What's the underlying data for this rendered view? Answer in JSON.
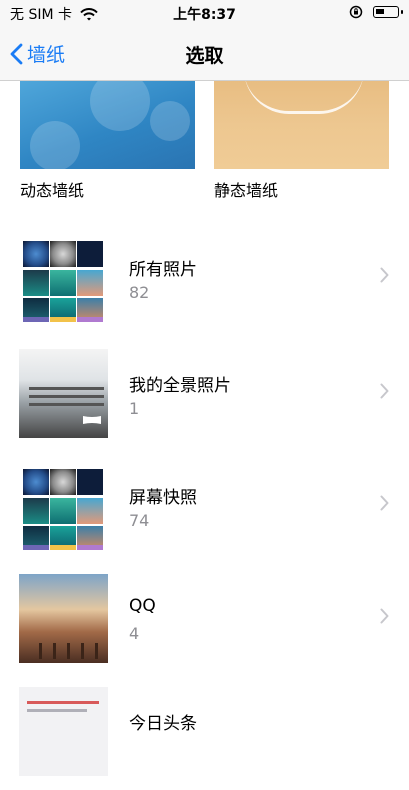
{
  "status_bar": {
    "carrier": "无 SIM 卡",
    "time": "上午8:37",
    "icons": [
      "wifi-icon",
      "rotation-lock-icon",
      "battery-icon"
    ]
  },
  "nav": {
    "back_label": "墙纸",
    "title": "选取"
  },
  "wallpaper_types": [
    {
      "label": "动态墙纸"
    },
    {
      "label": "静态墙纸"
    }
  ],
  "albums": [
    {
      "name": "所有照片",
      "count": "82"
    },
    {
      "name": "我的全景照片",
      "count": "1"
    },
    {
      "name": "屏幕快照",
      "count": "74"
    },
    {
      "name": "QQ",
      "count": "4"
    },
    {
      "name": "今日头条",
      "count": ""
    }
  ],
  "colors": {
    "accent": "#1a7cf5",
    "secondary_text": "#8e8e93",
    "chevron": "#c7c7cc"
  }
}
